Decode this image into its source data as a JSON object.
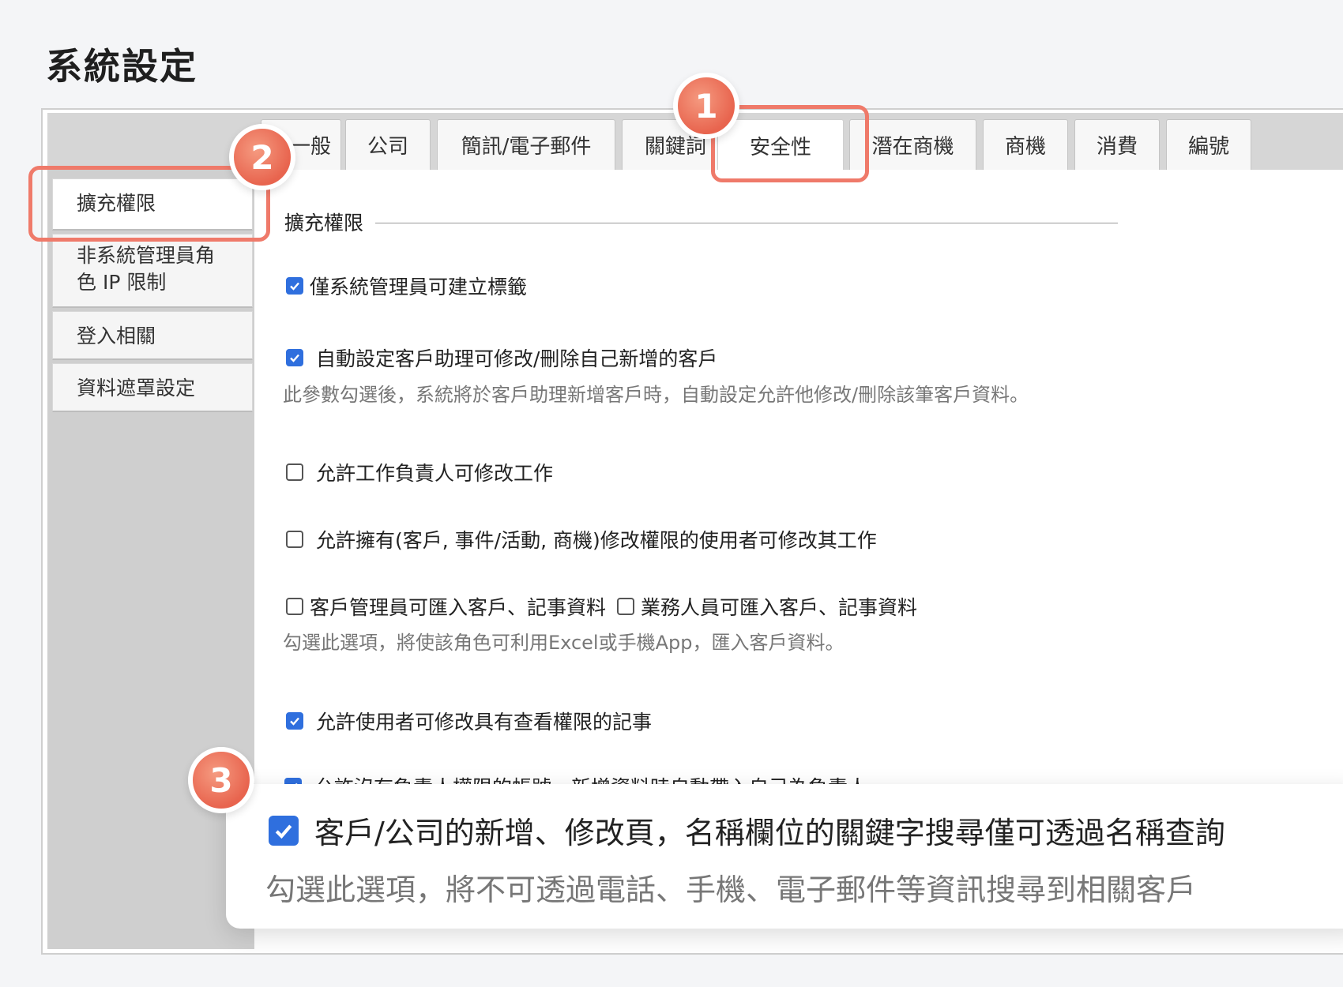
{
  "page": {
    "title": "系統設定"
  },
  "tabs": [
    {
      "label": "一般"
    },
    {
      "label": "公司"
    },
    {
      "label": "簡訊/電子郵件"
    },
    {
      "label": "關鍵詞"
    },
    {
      "label": "安全性",
      "active": true
    },
    {
      "label": "潛在商機"
    },
    {
      "label": "商機"
    },
    {
      "label": "消費"
    },
    {
      "label": "編號"
    }
  ],
  "sidebar": {
    "items": [
      {
        "label": "擴充權限",
        "active": true
      },
      {
        "label_line1": "非系統管理員角",
        "label_line2": "色 IP 限制"
      },
      {
        "label": "登入相關"
      },
      {
        "label": "資料遮罩設定"
      }
    ]
  },
  "section": {
    "title": "擴充權限"
  },
  "options": {
    "only_admin_tags": {
      "label": "僅系統管理員可建立標籤",
      "checked": true
    },
    "auto_assistant": {
      "label": "自動設定客戶助理可修改/刪除自己新增的客戶",
      "checked": true,
      "hint": "此參數勾選後，系統將於客戶助理新增客戶時，自動設定允許他修改/刪除該筆客戶資料。"
    },
    "task_owner_edit": {
      "label": "允許工作負責人可修改工作",
      "checked": false
    },
    "edit_perm_task": {
      "label": "允許擁有(客戶, 事件/活動, 商機)修改權限的使用者可修改其工作",
      "checked": false
    },
    "manager_import": {
      "label": "客戶管理員可匯入客戶、記事資料",
      "checked": false
    },
    "sales_import": {
      "label": "業務人員可匯入客戶、記事資料",
      "checked": false
    },
    "import_hint": "勾選此選項，將使該角色可利用Excel或手機App，匯入客戶資料。",
    "edit_viewable_notes": {
      "label": "允許使用者可修改具有查看權限的記事",
      "checked": true
    },
    "no_owner_account": {
      "label": "允許沒有負責人權限的帳號，新增資料時自動帶入自己為負責人",
      "checked": true
    }
  },
  "zoom": {
    "label": "客戶/公司的新增、修改頁，名稱欄位的關鍵字搜尋僅可透過名稱查詢",
    "checked": true,
    "hint": "勾選此選項，將不可透過電話、手機、電子郵件等資訊搜尋到相關客戶"
  },
  "badges": {
    "one": "1",
    "two": "2",
    "three": "3"
  },
  "colors": {
    "highlight": "#ef7a6a",
    "checkbox": "#2f6fde"
  }
}
